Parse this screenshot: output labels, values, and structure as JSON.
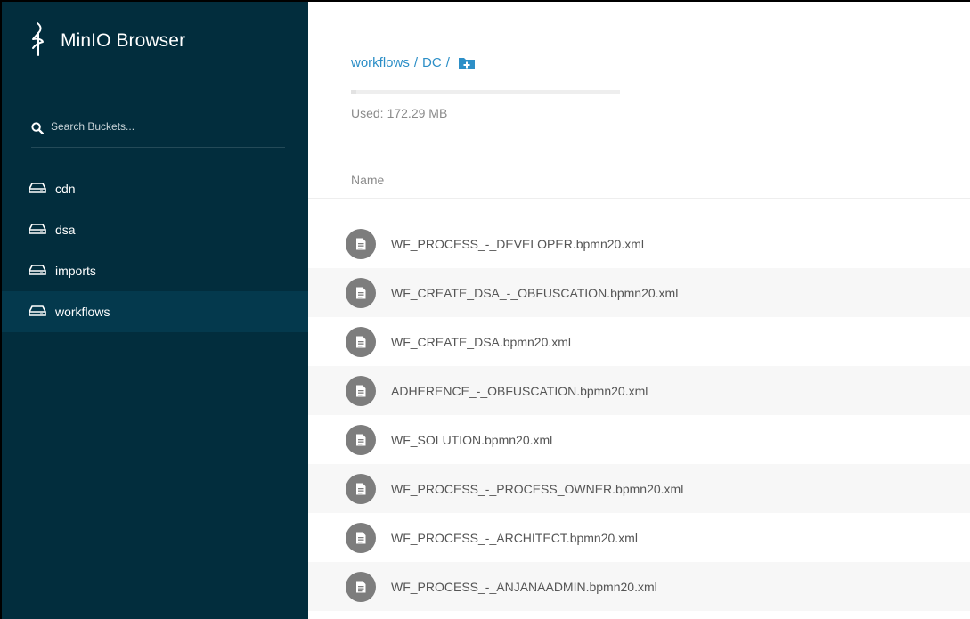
{
  "app": {
    "brand_name": "MinIO Browser",
    "accent_color": "#2d8fc7",
    "sidebar_color": "#022d3d"
  },
  "search": {
    "placeholder": "Search Buckets..."
  },
  "buckets": [
    {
      "label": "cdn",
      "icon": "drive-icon",
      "active": false
    },
    {
      "label": "dsa",
      "icon": "drive-icon",
      "active": false
    },
    {
      "label": "imports",
      "icon": "drive-icon",
      "active": false
    },
    {
      "label": "workflows",
      "icon": "drive-icon",
      "active": true
    }
  ],
  "breadcrumb": {
    "items": [
      "workflows",
      "DC"
    ],
    "separator": "/"
  },
  "usage": {
    "label": "Used:",
    "value": "172.29 MB"
  },
  "table": {
    "column_name": "Name",
    "files": [
      "WF_PROCESS_-_DEVELOPER.bpmn20.xml",
      "WF_CREATE_DSA_-_OBFUSCATION.bpmn20.xml",
      "WF_CREATE_DSA.bpmn20.xml",
      "ADHERENCE_-_OBFUSCATION.bpmn20.xml",
      "WF_SOLUTION.bpmn20.xml",
      "WF_PROCESS_-_PROCESS_OWNER.bpmn20.xml",
      "WF_PROCESS_-_ARCHITECT.bpmn20.xml",
      "WF_PROCESS_-_ANJANAADMIN.bpmn20.xml"
    ]
  }
}
